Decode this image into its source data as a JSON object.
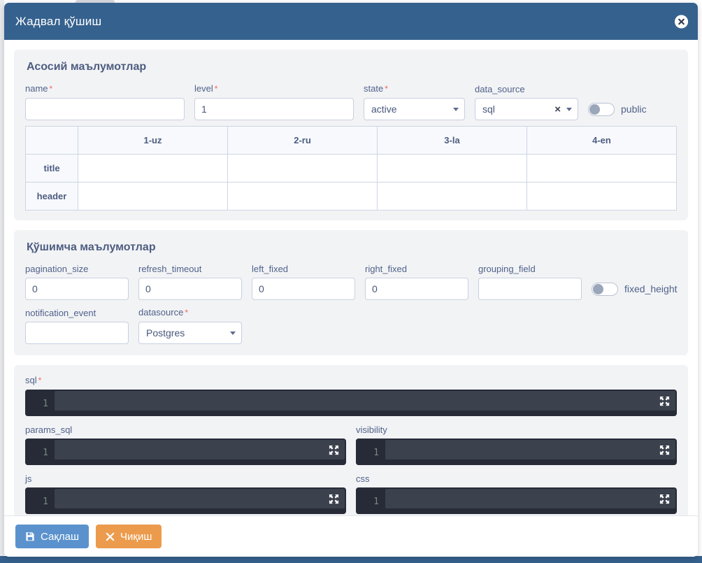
{
  "window": {
    "title": "Жадвал қўшиш",
    "close_icon": "close-circle-icon"
  },
  "sections": {
    "main": {
      "title": "Асосий маълумотлар",
      "fields": {
        "name": {
          "label": "name",
          "required": true,
          "value": "",
          "placeholder": ""
        },
        "level": {
          "label": "level",
          "required": true,
          "value": "1"
        },
        "state": {
          "label": "state",
          "required": true,
          "value": "active",
          "icon": "chevron-down-icon"
        },
        "data_source": {
          "label": "data_source",
          "required": false,
          "value": "sql",
          "clear_icon": "clear-x-icon",
          "icon": "chevron-down-icon"
        },
        "public": {
          "label": "public",
          "checked": false
        }
      },
      "table": {
        "columns": [
          "",
          "1-uz",
          "2-ru",
          "3-la",
          "4-en"
        ],
        "rows": [
          {
            "label": "title",
            "cells": [
              "",
              "",
              "",
              ""
            ]
          },
          {
            "label": "header",
            "cells": [
              "",
              "",
              "",
              ""
            ]
          }
        ]
      }
    },
    "extra": {
      "title": "Қўшимча маълумотлар",
      "fields": {
        "pagination_size": {
          "label": "pagination_size",
          "value": "0"
        },
        "refresh_timeout": {
          "label": "refresh_timeout",
          "value": "0"
        },
        "left_fixed": {
          "label": "left_fixed",
          "value": "0"
        },
        "right_fixed": {
          "label": "right_fixed",
          "value": "0"
        },
        "grouping_field": {
          "label": "grouping_field",
          "value": ""
        },
        "fixed_height": {
          "label": "fixed_height",
          "checked": false
        },
        "notification_event": {
          "label": "notification_event",
          "value": ""
        },
        "datasource": {
          "label": "datasource",
          "required": true,
          "value": "Postgres",
          "icon": "chevron-down-icon"
        }
      }
    },
    "code": {
      "editors": [
        {
          "label": "sql",
          "required": true,
          "line_number": "1",
          "content": "",
          "expand_icon": "expand-arrows-icon"
        },
        {
          "label": "params_sql",
          "required": false,
          "line_number": "1",
          "content": "",
          "expand_icon": "expand-arrows-icon"
        },
        {
          "label": "visibility",
          "required": false,
          "line_number": "1",
          "content": "",
          "expand_icon": "expand-arrows-icon"
        },
        {
          "label": "js",
          "required": false,
          "line_number": "1",
          "content": "",
          "expand_icon": "expand-arrows-icon"
        },
        {
          "label": "css",
          "required": false,
          "line_number": "1",
          "content": "",
          "expand_icon": "expand-arrows-icon"
        }
      ]
    }
  },
  "footer": {
    "save_label": "Сақлаш",
    "save_icon": "floppy-save-icon",
    "exit_label": "Чиқиш",
    "exit_icon": "x-close-icon"
  },
  "colors": {
    "header_blue": "#35618e",
    "panel_bg": "#f2f3f5",
    "label_text": "#50628a",
    "required_star": "#f4675b",
    "save_button": "#5b92cd",
    "exit_button": "#ec9b4c",
    "editor_bg": "#272b38",
    "editor_code_bg": "#3c414e"
  }
}
